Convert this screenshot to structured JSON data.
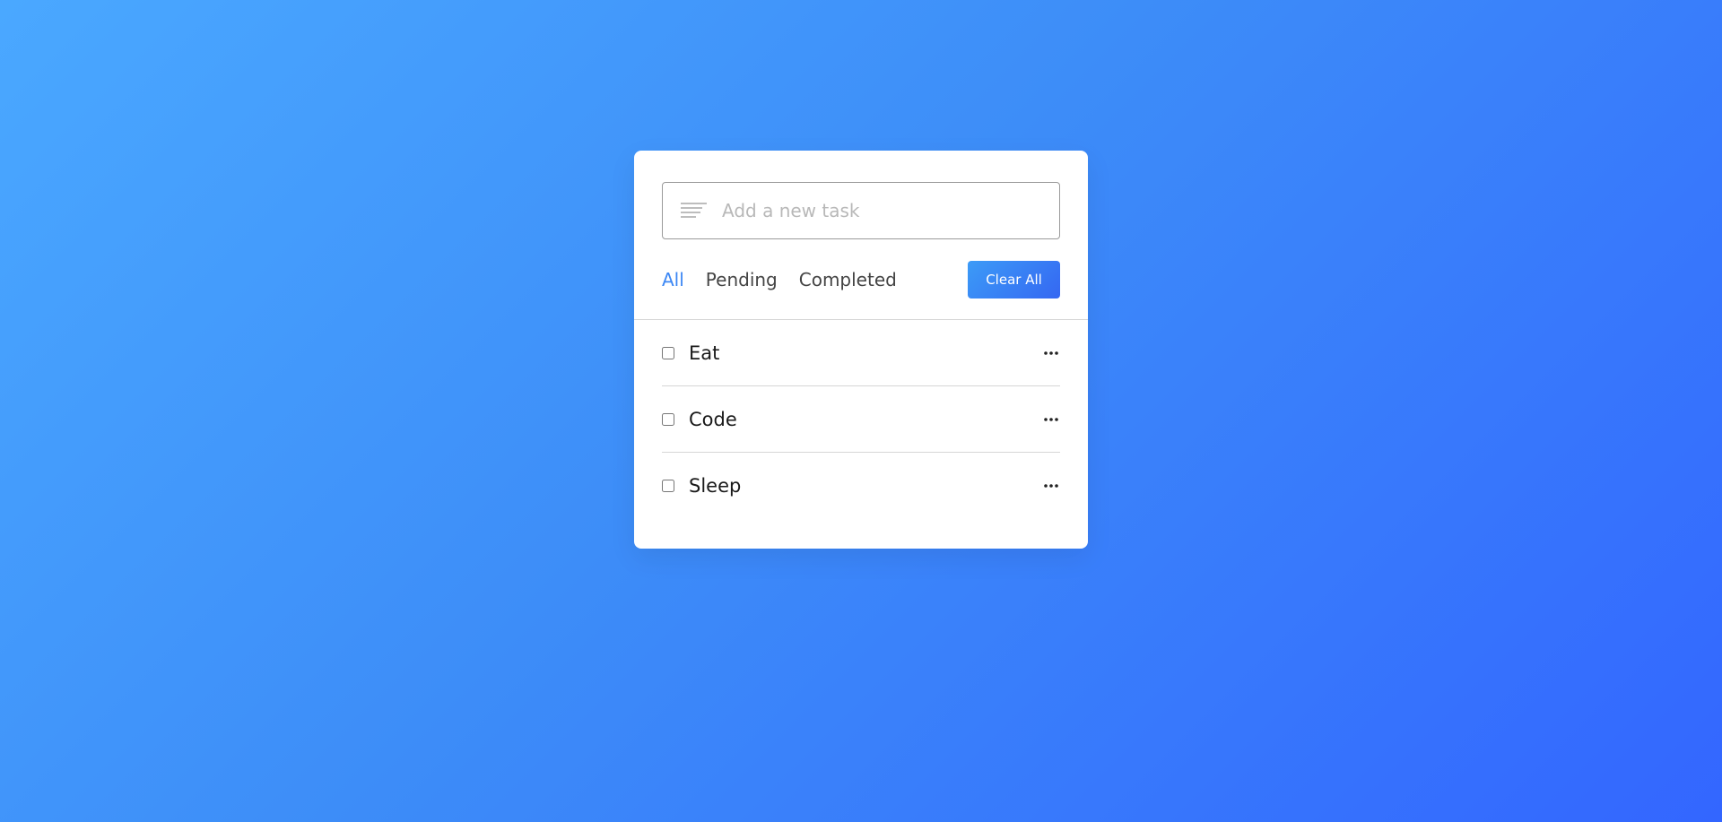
{
  "input": {
    "placeholder": "Add a new task",
    "value": "",
    "icon": "align-left-icon"
  },
  "filters": [
    {
      "label": "All",
      "active": true
    },
    {
      "label": "Pending",
      "active": false
    },
    {
      "label": "Completed",
      "active": false
    }
  ],
  "clear_button": {
    "label": "Clear All"
  },
  "tasks": [
    {
      "name": "Eat",
      "checked": false,
      "menu_icon": "more-horizontal-icon"
    },
    {
      "name": "Code",
      "checked": false,
      "menu_icon": "more-horizontal-icon"
    },
    {
      "name": "Sleep",
      "checked": false,
      "menu_icon": "more-horizontal-icon"
    }
  ],
  "colors": {
    "background_start": "#4AA8FF",
    "background_end": "#3366FF",
    "accent": "#3C87F4",
    "button_start": "#3C9BF7",
    "button_end": "#3567F2"
  }
}
